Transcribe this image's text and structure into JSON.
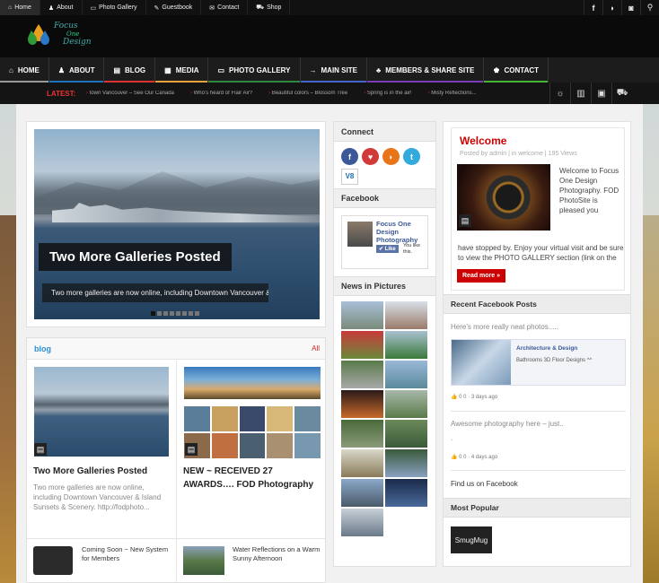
{
  "topbar": {
    "links": [
      {
        "icon": "home-icon",
        "label": "Home"
      },
      {
        "icon": "user-icon",
        "label": "About"
      },
      {
        "icon": "image-icon",
        "label": "Photo Gallery"
      },
      {
        "icon": "guestbook-icon",
        "label": "Guestbook"
      },
      {
        "icon": "mail-icon",
        "label": "Contact"
      },
      {
        "icon": "cart-icon",
        "label": "Shop"
      }
    ],
    "social_icons": [
      "facebook-icon",
      "rss-icon",
      "camera-icon",
      "search-icon"
    ]
  },
  "logo": {
    "line1": "Focus",
    "line2": "One",
    "line3": "Design"
  },
  "nav": [
    {
      "label": "HOME",
      "icon": "home-icon",
      "color": "#999999"
    },
    {
      "label": "ABOUT",
      "icon": "user-icon",
      "color": "#1e73be"
    },
    {
      "label": "BLOG",
      "icon": "news-icon",
      "color": "#dd3333"
    },
    {
      "label": "MEDIA",
      "icon": "film-icon",
      "color": "#e8a33c"
    },
    {
      "label": "PHOTO GALLERY",
      "icon": "image-icon",
      "color": "#2b8a3e"
    },
    {
      "label": "MAIN SITE",
      "icon": "arrow-icon",
      "color": "#4466cc"
    },
    {
      "label": "MEMBERS & SHARE SITE",
      "icon": "group-icon",
      "color": "#7a3cb8"
    },
    {
      "label": "CONTACT",
      "icon": "person-icon",
      "color": "#44b836"
    }
  ],
  "news": {
    "label": "LATEST:",
    "items": [
      "town Vancouver – See Our Canada",
      "Who's heard of Flair Air?",
      "Beautiful colors – Blossom Tree",
      "Spring is in the air!",
      "Misty Reflections..."
    ],
    "icons": [
      "sun-icon",
      "book-icon",
      "film-icon",
      "cart-icon"
    ]
  },
  "slider": {
    "title": "Two More Galleries Posted",
    "caption": "Two more galleries are now online, including Downtown Vancouver &...",
    "dots": 8,
    "active_dot": 0
  },
  "blog": {
    "header": "blog",
    "all_label": "All",
    "posts": [
      {
        "title": "Two More Galleries Posted",
        "excerpt": "Two more galleries are now online, including Downtown Vancouver & Island Sunsets & Scenery. http://fodphoto..."
      },
      {
        "title": "NEW ~ RECEIVED 27 AWARDS…. FOD Photography",
        "excerpt": ""
      }
    ],
    "small_posts": [
      {
        "title": "Coming Soon ~ New System for Members"
      },
      {
        "title": "Water Reflections on a Warm Sunny Afternoon"
      }
    ]
  },
  "connect": {
    "header": "Connect",
    "icons": [
      {
        "name": "facebook-icon",
        "color": "#3b5998"
      },
      {
        "name": "heart-icon",
        "color": "#d23a3a"
      },
      {
        "name": "rss-icon",
        "color": "#e8751a"
      },
      {
        "name": "twitter-icon",
        "color": "#33aadd"
      },
      {
        "name": "vimeo-icon",
        "color": "#1a6fb0"
      }
    ]
  },
  "facebook": {
    "header": "Facebook",
    "page_name": "Focus One Design Photography",
    "like_label": "Like",
    "like_text": "You like this."
  },
  "pictures": {
    "header": "News in Pictures",
    "count": 16
  },
  "welcome": {
    "title": "Welcome",
    "meta": "Posted by admin | in welcome | 195 Views",
    "text_right": "Welcome to Focus One Design Photography. FOD PhotoSite is pleased you",
    "text_full": "have stopped by. Enjoy your virtual visit and be sure to view the PHOTO GALLERY section (link on the",
    "read_more": "Read more »"
  },
  "recent_fb": {
    "header": "Recent Facebook Posts",
    "post1": "Here's more really neat photos.....",
    "card_title": "Architecture & Design",
    "card_sub": "Bathrooms 3D Floor Designs ^^",
    "meta1": "0  0 · 3 days ago",
    "post2": "Awesome photography here – just..",
    "post2b": ".",
    "meta2": "0  0 · 4 days ago",
    "find_us": "Find us on Facebook"
  },
  "popular": {
    "header": "Most Popular",
    "logo": "SmugMug"
  }
}
